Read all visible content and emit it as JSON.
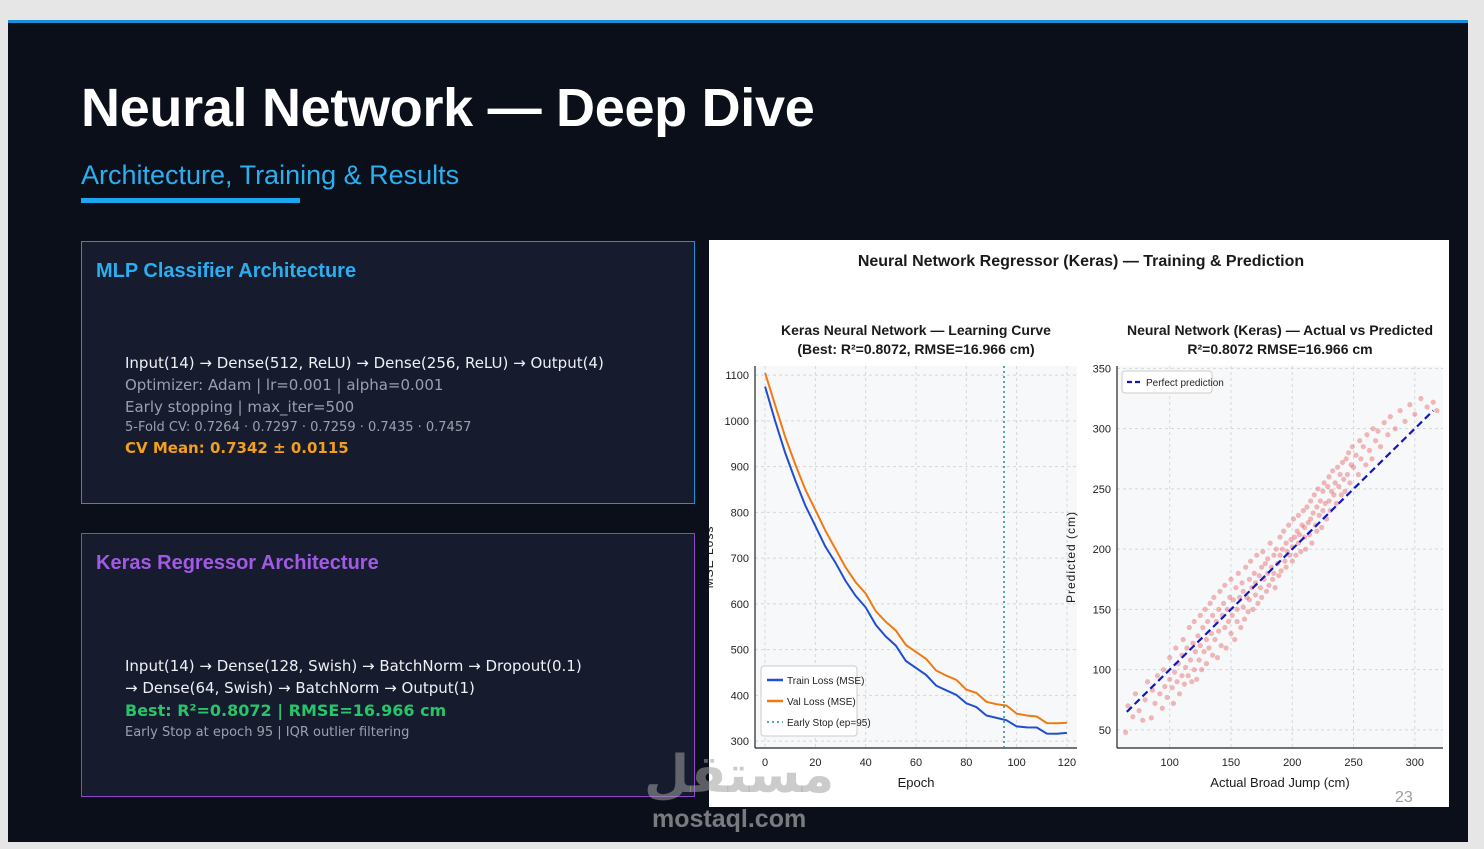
{
  "slide": {
    "title": "Neural Network — Deep Dive",
    "subtitle": "Architecture, Training & Results",
    "page_number": "23"
  },
  "mlp_card": {
    "heading": "MLP Classifier Architecture",
    "lines": [
      "Input(14) → Dense(512, ReLU) → Dense(256, ReLU) → Output(4)",
      "Optimizer: Adam | lr=0.001 | alpha=0.001",
      "Early stopping | max_iter=500",
      "5-Fold CV: 0.7264 · 0.7297 · 0.7259 · 0.7435 · 0.7457",
      "CV Mean: 0.7342 ± 0.0115"
    ]
  },
  "keras_card": {
    "heading": "Keras Regressor Architecture",
    "lines": [
      "Input(14) → Dense(128, Swish) → BatchNorm → Dropout(0.1)",
      "→ Dense(64, Swish) → BatchNorm → Output(1)",
      "Best: R²=0.8072 | RMSE=16.966 cm",
      "Early Stop at epoch 95 | IQR outlier filtering"
    ]
  },
  "figure": {
    "suptitle": "Neural Network Regressor (Keras) — Training & Prediction"
  },
  "watermark": {
    "arabic": "مستقل",
    "latin": "mostaql.com"
  },
  "colors": {
    "accent_blue": "#1aa7ef",
    "accent_purple": "#a25ae6",
    "metric_orange": "#f29e1e",
    "metric_green": "#27c46b",
    "train_line": "#1f4fd0",
    "val_line": "#f07a12",
    "early_stop_line": "#2a8a8a",
    "scatter_point": "#e03a3a",
    "perfect_line": "#1515c0"
  },
  "chart_data": [
    {
      "type": "line",
      "title": "Keras Neural Network — Learning Curve",
      "subtitle": "(Best: R²=0.8072, RMSE=16.966 cm)",
      "xlabel": "Epoch",
      "ylabel": "MSE Loss",
      "xlim": [
        -4,
        124
      ],
      "ylim": [
        285,
        1120
      ],
      "xticks": [
        0,
        20,
        40,
        60,
        80,
        100,
        120
      ],
      "yticks": [
        300,
        400,
        500,
        600,
        700,
        800,
        900,
        1000,
        1100
      ],
      "grid": true,
      "legend": "bottom-left",
      "series": [
        {
          "name": "Train Loss (MSE)",
          "x": [
            0,
            4,
            8,
            12,
            16,
            20,
            24,
            28,
            32,
            36,
            40,
            44,
            48,
            52,
            56,
            60,
            64,
            68,
            72,
            76,
            80,
            84,
            88,
            92,
            96,
            100,
            104,
            108,
            112,
            116,
            120
          ],
          "values": [
            1075,
            1000,
            930,
            870,
            815,
            770,
            725,
            690,
            650,
            620,
            590,
            560,
            530,
            505,
            480,
            460,
            440,
            425,
            410,
            395,
            385,
            372,
            362,
            352,
            342,
            337,
            330,
            325,
            320,
            315,
            312
          ]
        },
        {
          "name": "Val Loss (MSE)",
          "x": [
            0,
            4,
            8,
            12,
            16,
            20,
            24,
            28,
            32,
            36,
            40,
            44,
            48,
            52,
            56,
            60,
            64,
            68,
            72,
            76,
            80,
            84,
            88,
            92,
            96,
            100,
            104,
            108,
            112,
            116,
            120
          ],
          "values": [
            1105,
            1035,
            965,
            905,
            850,
            805,
            760,
            720,
            680,
            650,
            620,
            590,
            562,
            538,
            515,
            495,
            475,
            458,
            442,
            428,
            415,
            403,
            392,
            382,
            374,
            365,
            356,
            349,
            343,
            338,
            334
          ]
        },
        {
          "name": "Early Stop (ep=95)",
          "x": [
            95,
            95
          ],
          "values": [
            285,
            1120
          ]
        }
      ]
    },
    {
      "type": "scatter",
      "title": "Neural Network (Keras) — Actual vs Predicted",
      "subtitle": "R²=0.8072  RMSE=16.966 cm",
      "xlabel": "Actual Broad Jump (cm)",
      "ylabel": "Predicted (cm)",
      "xlim": [
        57,
        323
      ],
      "ylim": [
        35,
        352
      ],
      "xticks": [
        100,
        150,
        200,
        250,
        300
      ],
      "yticks": [
        50,
        100,
        150,
        200,
        250,
        300,
        350
      ],
      "grid": true,
      "legend": "top-left",
      "series": [
        {
          "name": "Perfect prediction",
          "x": [
            65,
            315
          ],
          "values": [
            65,
            315
          ]
        }
      ],
      "points": [
        [
          64,
          48
        ],
        [
          66,
          70
        ],
        [
          70,
          61
        ],
        [
          72,
          80
        ],
        [
          75,
          66
        ],
        [
          78,
          58
        ],
        [
          80,
          75
        ],
        [
          82,
          90
        ],
        [
          85,
          60
        ],
        [
          86,
          83
        ],
        [
          88,
          72
        ],
        [
          90,
          95
        ],
        [
          92,
          80
        ],
        [
          94,
          68
        ],
        [
          95,
          100
        ],
        [
          96,
          86
        ],
        [
          98,
          77
        ],
        [
          100,
          92
        ],
        [
          100,
          110
        ],
        [
          102,
          85
        ],
        [
          103,
          72
        ],
        [
          104,
          98
        ],
        [
          105,
          118
        ],
        [
          106,
          90
        ],
        [
          107,
          105
        ],
        [
          108,
          80
        ],
        [
          110,
          112
        ],
        [
          110,
          95
        ],
        [
          111,
          125
        ],
        [
          112,
          88
        ],
        [
          113,
          102
        ],
        [
          114,
          118
        ],
        [
          115,
          95
        ],
        [
          116,
          135
        ],
        [
          117,
          108
        ],
        [
          118,
          90
        ],
        [
          119,
          122
        ],
        [
          120,
          100
        ],
        [
          120,
          140
        ],
        [
          121,
          115
        ],
        [
          122,
          92
        ],
        [
          123,
          128
        ],
        [
          124,
          108
        ],
        [
          125,
          145
        ],
        [
          125,
          120
        ],
        [
          126,
          100
        ],
        [
          127,
          135
        ],
        [
          128,
          115
        ],
        [
          129,
          150
        ],
        [
          130,
          125
        ],
        [
          130,
          105
        ],
        [
          131,
          140
        ],
        [
          132,
          118
        ],
        [
          133,
          155
        ],
        [
          134,
          130
        ],
        [
          135,
          112
        ],
        [
          135,
          145
        ],
        [
          136,
          160
        ],
        [
          137,
          125
        ],
        [
          138,
          140
        ],
        [
          139,
          110
        ],
        [
          140,
          150
        ],
        [
          140,
          132
        ],
        [
          141,
          165
        ],
        [
          142,
          120
        ],
        [
          143,
          145
        ],
        [
          144,
          155
        ],
        [
          145,
          135
        ],
        [
          145,
          170
        ],
        [
          146,
          118
        ],
        [
          147,
          150
        ],
        [
          148,
          140
        ],
        [
          149,
          160
        ],
        [
          150,
          130
        ],
        [
          150,
          175
        ],
        [
          151,
          145
        ],
        [
          152,
          158
        ],
        [
          153,
          125
        ],
        [
          154,
          168
        ],
        [
          155,
          150
        ],
        [
          155,
          140
        ],
        [
          156,
          180
        ],
        [
          157,
          160
        ],
        [
          158,
          135
        ],
        [
          159,
          172
        ],
        [
          160,
          152
        ],
        [
          160,
          165
        ],
        [
          161,
          142
        ],
        [
          162,
          185
        ],
        [
          163,
          160
        ],
        [
          164,
          148
        ],
        [
          165,
          175
        ],
        [
          165,
          158
        ],
        [
          166,
          190
        ],
        [
          167,
          168
        ],
        [
          168,
          150
        ],
        [
          169,
          180
        ],
        [
          170,
          162
        ],
        [
          170,
          172
        ],
        [
          171,
          195
        ],
        [
          172,
          155
        ],
        [
          173,
          178
        ],
        [
          174,
          168
        ],
        [
          175,
          185
        ],
        [
          175,
          160
        ],
        [
          176,
          198
        ],
        [
          177,
          175
        ],
        [
          178,
          188
        ],
        [
          179,
          165
        ],
        [
          180,
          180
        ],
        [
          180,
          192
        ],
        [
          181,
          170
        ],
        [
          182,
          205
        ],
        [
          183,
          185
        ],
        [
          184,
          175
        ],
        [
          185,
          195
        ],
        [
          185,
          180
        ],
        [
          186,
          168
        ],
        [
          187,
          200
        ],
        [
          188,
          188
        ],
        [
          189,
          178
        ],
        [
          190,
          210
        ],
        [
          190,
          195
        ],
        [
          191,
          182
        ],
        [
          192,
          200
        ],
        [
          193,
          215
        ],
        [
          194,
          190
        ],
        [
          195,
          205
        ],
        [
          195,
          185
        ],
        [
          196,
          198
        ],
        [
          197,
          220
        ],
        [
          198,
          195
        ],
        [
          199,
          208
        ],
        [
          200,
          190
        ],
        [
          200,
          202
        ],
        [
          201,
          225
        ],
        [
          202,
          210
        ],
        [
          203,
          195
        ],
        [
          204,
          215
        ],
        [
          205,
          205
        ],
        [
          205,
          228
        ],
        [
          206,
          212
        ],
        [
          207,
          198
        ],
        [
          208,
          220
        ],
        [
          209,
          232
        ],
        [
          210,
          210
        ],
        [
          210,
          218
        ],
        [
          211,
          200
        ],
        [
          212,
          235
        ],
        [
          213,
          222
        ],
        [
          214,
          212
        ],
        [
          215,
          240
        ],
        [
          215,
          225
        ],
        [
          216,
          205
        ],
        [
          217,
          230
        ],
        [
          218,
          245
        ],
        [
          219,
          220
        ],
        [
          220,
          235
        ],
        [
          220,
          215
        ],
        [
          221,
          250
        ],
        [
          222,
          228
        ],
        [
          223,
          240
        ],
        [
          224,
          218
        ],
        [
          225,
          248
        ],
        [
          225,
          232
        ],
        [
          226,
          255
        ],
        [
          227,
          238
        ],
        [
          228,
          225
        ],
        [
          229,
          252
        ],
        [
          230,
          240
        ],
        [
          230,
          260
        ],
        [
          231,
          232
        ],
        [
          232,
          248
        ],
        [
          233,
          265
        ],
        [
          234,
          245
        ],
        [
          235,
          255
        ],
        [
          236,
          238
        ],
        [
          237,
          268
        ],
        [
          238,
          252
        ],
        [
          239,
          262
        ],
        [
          240,
          245
        ],
        [
          241,
          272
        ],
        [
          242,
          258
        ],
        [
          243,
          248
        ],
        [
          244,
          275
        ],
        [
          245,
          262
        ],
        [
          246,
          280
        ],
        [
          247,
          255
        ],
        [
          248,
          270
        ],
        [
          249,
          285
        ],
        [
          250,
          268
        ],
        [
          252,
          278
        ],
        [
          254,
          262
        ],
        [
          255,
          290
        ],
        [
          256,
          275
        ],
        [
          258,
          285
        ],
        [
          260,
          270
        ],
        [
          261,
          295
        ],
        [
          263,
          282
        ],
        [
          265,
          275
        ],
        [
          266,
          300
        ],
        [
          268,
          290
        ],
        [
          270,
          298
        ],
        [
          272,
          285
        ],
        [
          275,
          305
        ],
        [
          278,
          295
        ],
        [
          280,
          310
        ],
        [
          284,
          300
        ],
        [
          288,
          315
        ],
        [
          292,
          306
        ],
        [
          296,
          320
        ],
        [
          300,
          312
        ],
        [
          305,
          325
        ],
        [
          310,
          318
        ],
        [
          315,
          322
        ],
        [
          318,
          315
        ]
      ]
    }
  ]
}
